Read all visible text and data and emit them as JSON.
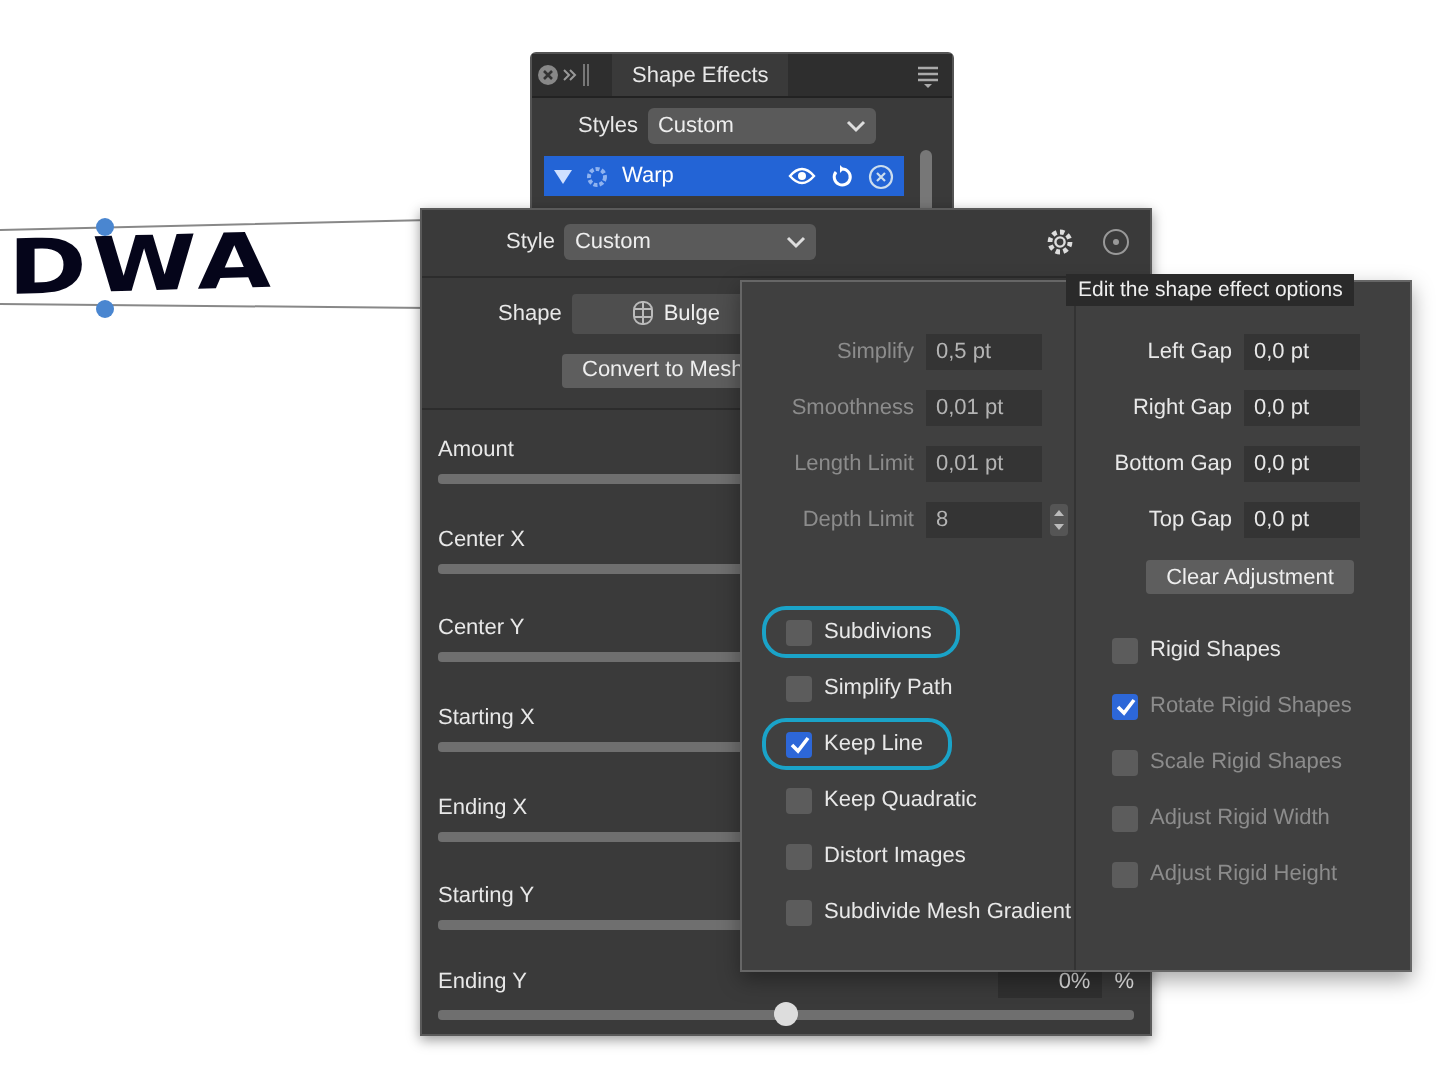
{
  "canvas": {
    "text": "DWA"
  },
  "panel": {
    "title": "Shape Effects",
    "styles_label": "Styles",
    "styles_value": "Custom",
    "effects": [
      {
        "name": "Warp",
        "expanded": true,
        "selected": true
      }
    ]
  },
  "warp_popover": {
    "style_label": "Style",
    "style_value": "Custom",
    "shape_label": "Shape",
    "shape_value": "Bulge",
    "convert_button": "Convert to Mesh",
    "sliders": [
      {
        "label": "Amount"
      },
      {
        "label": "Center X"
      },
      {
        "label": "Center Y"
      },
      {
        "label": "Starting X"
      },
      {
        "label": "Ending X"
      },
      {
        "label": "Starting Y"
      },
      {
        "label": "Ending Y",
        "value": "0%",
        "unit": "%",
        "level": 0.5
      }
    ]
  },
  "tooltip": "Edit the shape effect options",
  "options": {
    "left_fields": [
      {
        "label": "Simplify",
        "value": "0,5 pt",
        "disabled": true,
        "kind": "field"
      },
      {
        "label": "Smoothness",
        "value": "0,01 pt",
        "disabled": true,
        "kind": "field"
      },
      {
        "label": "Length Limit",
        "value": "0,01 pt",
        "disabled": true,
        "kind": "field"
      },
      {
        "label": "Depth Limit",
        "value": "8",
        "disabled": true,
        "kind": "stepper"
      }
    ],
    "right_fields": [
      {
        "label": "Left Gap",
        "value": "0,0 pt",
        "disabled": false,
        "kind": "field"
      },
      {
        "label": "Right Gap",
        "value": "0,0 pt",
        "disabled": false,
        "kind": "field"
      },
      {
        "label": "Bottom Gap",
        "value": "0,0 pt",
        "disabled": false,
        "kind": "field"
      },
      {
        "label": "Top Gap",
        "value": "0,0 pt",
        "disabled": false,
        "kind": "field"
      }
    ],
    "clear_button": "Clear Adjustment",
    "left_checks": [
      {
        "label": "Subdivions",
        "checked": false,
        "disabled": false,
        "highlighted": true
      },
      {
        "label": "Simplify Path",
        "checked": false,
        "disabled": false,
        "highlighted": false
      },
      {
        "label": "Keep Line",
        "checked": true,
        "disabled": false,
        "highlighted": true
      },
      {
        "label": "Keep Quadratic",
        "checked": false,
        "disabled": false,
        "highlighted": false
      },
      {
        "label": "Distort Images",
        "checked": false,
        "disabled": false,
        "highlighted": false
      },
      {
        "label": "Subdivide Mesh Gradient",
        "checked": false,
        "disabled": false,
        "highlighted": false
      }
    ],
    "right_checks": [
      {
        "label": "Rigid Shapes",
        "checked": false,
        "disabled": false,
        "highlighted": false
      },
      {
        "label": "Rotate Rigid Shapes",
        "checked": true,
        "disabled": true,
        "highlighted": false
      },
      {
        "label": "Scale Rigid Shapes",
        "checked": false,
        "disabled": true,
        "highlighted": false
      },
      {
        "label": "Adjust Rigid Width",
        "checked": false,
        "disabled": true,
        "highlighted": false
      },
      {
        "label": "Adjust Rigid Height",
        "checked": false,
        "disabled": true,
        "highlighted": false
      }
    ]
  }
}
